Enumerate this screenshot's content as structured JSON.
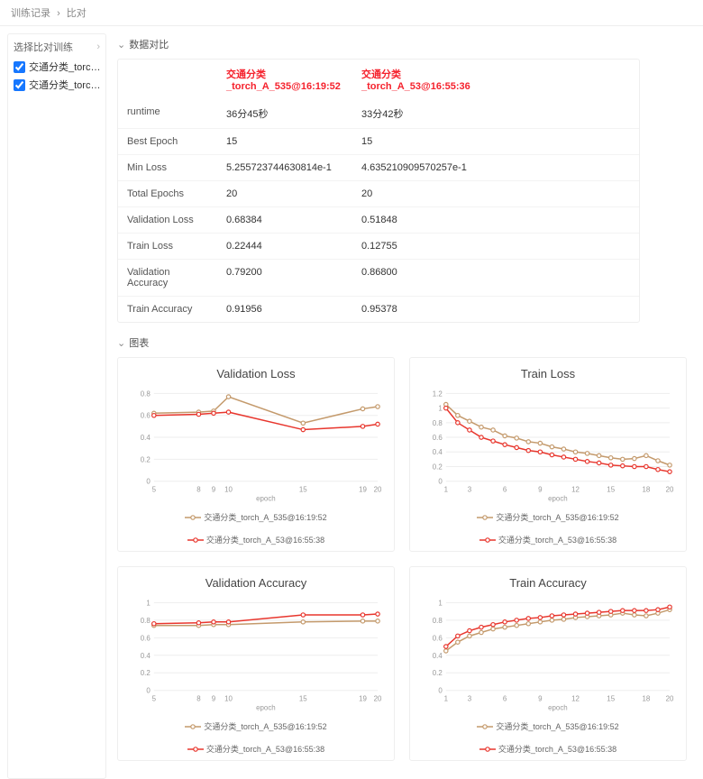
{
  "breadcrumb": {
    "a": "训练记录",
    "b": "比对"
  },
  "sidebar": {
    "title": "选择比对训练",
    "items": [
      {
        "label": "交通分类_torc…"
      },
      {
        "label": "交通分类_torc…"
      }
    ]
  },
  "dataSec": "数据对比",
  "chartSec": "图表",
  "cols": {
    "c1": "交通分类_torch_A_535@16:19:52",
    "c2": "交通分类_torch_A_53@16:55:36"
  },
  "rows": [
    {
      "lab": "runtime",
      "c1": "36分45秒",
      "c2": "33分42秒"
    },
    {
      "lab": "Best Epoch",
      "c1": "15",
      "c2": "15"
    },
    {
      "lab": "Min Loss",
      "c1": "5.255723744630814e-1",
      "c2": "4.635210909570257e-1"
    },
    {
      "lab": "Total Epochs",
      "c1": "20",
      "c2": "20"
    },
    {
      "lab": "Validation Loss",
      "c1": "0.68384",
      "c2": "0.51848"
    },
    {
      "lab": "Train Loss",
      "c1": "0.22444",
      "c2": "0.12755"
    },
    {
      "lab": "Validation Accuracy",
      "c1": "0.79200",
      "c2": "0.86800"
    },
    {
      "lab": "Train Accuracy",
      "c1": "0.91956",
      "c2": "0.95378"
    }
  ],
  "legend": {
    "s1": "交通分类_torch_A_535@16:19:52",
    "s2": "交通分类_torch_A_53@16:55:38"
  },
  "chart_data": [
    {
      "type": "line",
      "title": "Validation Loss",
      "xlabel": "epoch",
      "x": [
        5,
        8,
        9,
        10,
        15,
        19,
        20
      ],
      "xticks": [
        5,
        8,
        9,
        10,
        15,
        19,
        20
      ],
      "ylim": [
        0,
        0.8
      ],
      "yticks": [
        0,
        0.2,
        0.4,
        0.6,
        0.8
      ],
      "series": [
        {
          "name": "交通分类_torch_A_535@16:19:52",
          "values": [
            0.62,
            0.63,
            0.64,
            0.77,
            0.53,
            0.66,
            0.68
          ]
        },
        {
          "name": "交通分类_torch_A_53@16:55:38",
          "values": [
            0.6,
            0.61,
            0.62,
            0.63,
            0.47,
            0.5,
            0.52
          ]
        }
      ]
    },
    {
      "type": "line",
      "title": "Train Loss",
      "xlabel": "epoch",
      "x": [
        1,
        2,
        3,
        4,
        5,
        6,
        7,
        8,
        9,
        10,
        11,
        12,
        13,
        14,
        15,
        16,
        17,
        18,
        19,
        20
      ],
      "xticks": [
        1,
        3,
        6,
        9,
        12,
        15,
        18,
        20
      ],
      "ylim": [
        0,
        1.2
      ],
      "yticks": [
        0,
        0.2,
        0.4,
        0.6,
        0.8,
        1.0,
        1.2
      ],
      "series": [
        {
          "name": "交通分类_torch_A_535@16:19:52",
          "values": [
            1.05,
            0.9,
            0.82,
            0.74,
            0.7,
            0.62,
            0.59,
            0.54,
            0.52,
            0.47,
            0.44,
            0.4,
            0.38,
            0.35,
            0.32,
            0.3,
            0.31,
            0.35,
            0.28,
            0.22
          ]
        },
        {
          "name": "交通分类_torch_A_53@16:55:38",
          "values": [
            1.0,
            0.8,
            0.7,
            0.6,
            0.55,
            0.5,
            0.46,
            0.42,
            0.4,
            0.36,
            0.33,
            0.3,
            0.27,
            0.25,
            0.22,
            0.21,
            0.2,
            0.2,
            0.16,
            0.13
          ]
        }
      ]
    },
    {
      "type": "line",
      "title": "Validation Accuracy",
      "xlabel": "epoch",
      "x": [
        5,
        8,
        9,
        10,
        15,
        19,
        20
      ],
      "xticks": [
        5,
        8,
        9,
        10,
        15,
        19,
        20
      ],
      "ylim": [
        0,
        1
      ],
      "yticks": [
        0,
        0.2,
        0.4,
        0.6,
        0.8,
        1.0
      ],
      "series": [
        {
          "name": "交通分类_torch_A_535@16:19:52",
          "values": [
            0.74,
            0.74,
            0.75,
            0.75,
            0.78,
            0.79,
            0.79
          ]
        },
        {
          "name": "交通分类_torch_A_53@16:55:38",
          "values": [
            0.76,
            0.77,
            0.78,
            0.78,
            0.86,
            0.86,
            0.87
          ]
        }
      ]
    },
    {
      "type": "line",
      "title": "Train Accuracy",
      "xlabel": "epoch",
      "x": [
        1,
        2,
        3,
        4,
        5,
        6,
        7,
        8,
        9,
        10,
        11,
        12,
        13,
        14,
        15,
        16,
        17,
        18,
        19,
        20
      ],
      "xticks": [
        1,
        3,
        6,
        9,
        12,
        15,
        18,
        20
      ],
      "ylim": [
        0,
        1
      ],
      "yticks": [
        0,
        0.2,
        0.4,
        0.6,
        0.8,
        1.0
      ],
      "series": [
        {
          "name": "交通分类_torch_A_535@16:19:52",
          "values": [
            0.45,
            0.55,
            0.62,
            0.66,
            0.7,
            0.72,
            0.74,
            0.76,
            0.78,
            0.8,
            0.81,
            0.83,
            0.84,
            0.85,
            0.86,
            0.88,
            0.86,
            0.85,
            0.88,
            0.92
          ]
        },
        {
          "name": "交通分类_torch_A_53@16:55:38",
          "values": [
            0.5,
            0.62,
            0.68,
            0.72,
            0.75,
            0.78,
            0.8,
            0.82,
            0.83,
            0.85,
            0.86,
            0.87,
            0.88,
            0.89,
            0.9,
            0.91,
            0.91,
            0.91,
            0.92,
            0.95
          ]
        }
      ]
    }
  ]
}
